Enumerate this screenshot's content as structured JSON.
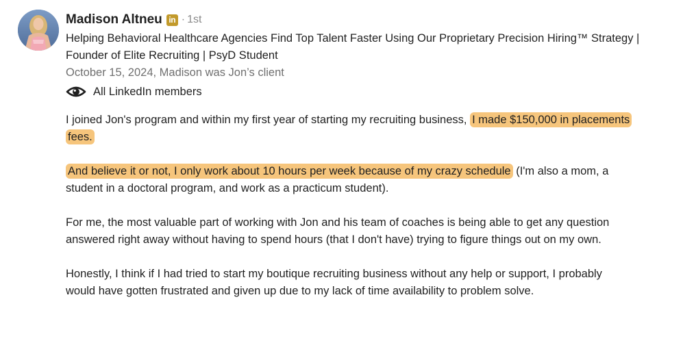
{
  "author": {
    "name": "Madison Altneu",
    "linkedin_badge": "in",
    "separator": "·",
    "connection_degree": "1st",
    "headline": "Helping Behavioral Healthcare Agencies Find Top Talent Faster Using Our Proprietary Precision Hiring™ Strategy | Founder of Elite Recruiting | PsyD Student",
    "avatar_icon": "profile-photo"
  },
  "meta": {
    "date_relationship": "October 15, 2024, Madison was Jon’s client"
  },
  "visibility": {
    "icon": "eye-icon",
    "label": "All LinkedIn members"
  },
  "recommendation": {
    "p1_before": "I joined Jon's program and within my first year of starting my recruiting business, ",
    "p1_highlight": "I made $150,000 in placements fees.",
    "p2_highlight": "And believe it or not, I only work about 10 hours per week because of my crazy schedule",
    "p2_after": " (I'm also a mom, a student in a doctoral program, and work as a practicum student).",
    "p3": "For me, the most valuable part of working with Jon and his team of coaches is being able to get any question answered right away without having to spend hours (that I don't have) trying to figure things out on my own.",
    "p4": "Honestly, I think if I had tried to start my boutique recruiting business without any help or support, I probably would have gotten frustrated and given up due to my lack of time availability to problem solve."
  },
  "colors": {
    "highlight": "#f6c57c",
    "badge": "#c29a2b",
    "muted_text": "#6f6f6f"
  }
}
